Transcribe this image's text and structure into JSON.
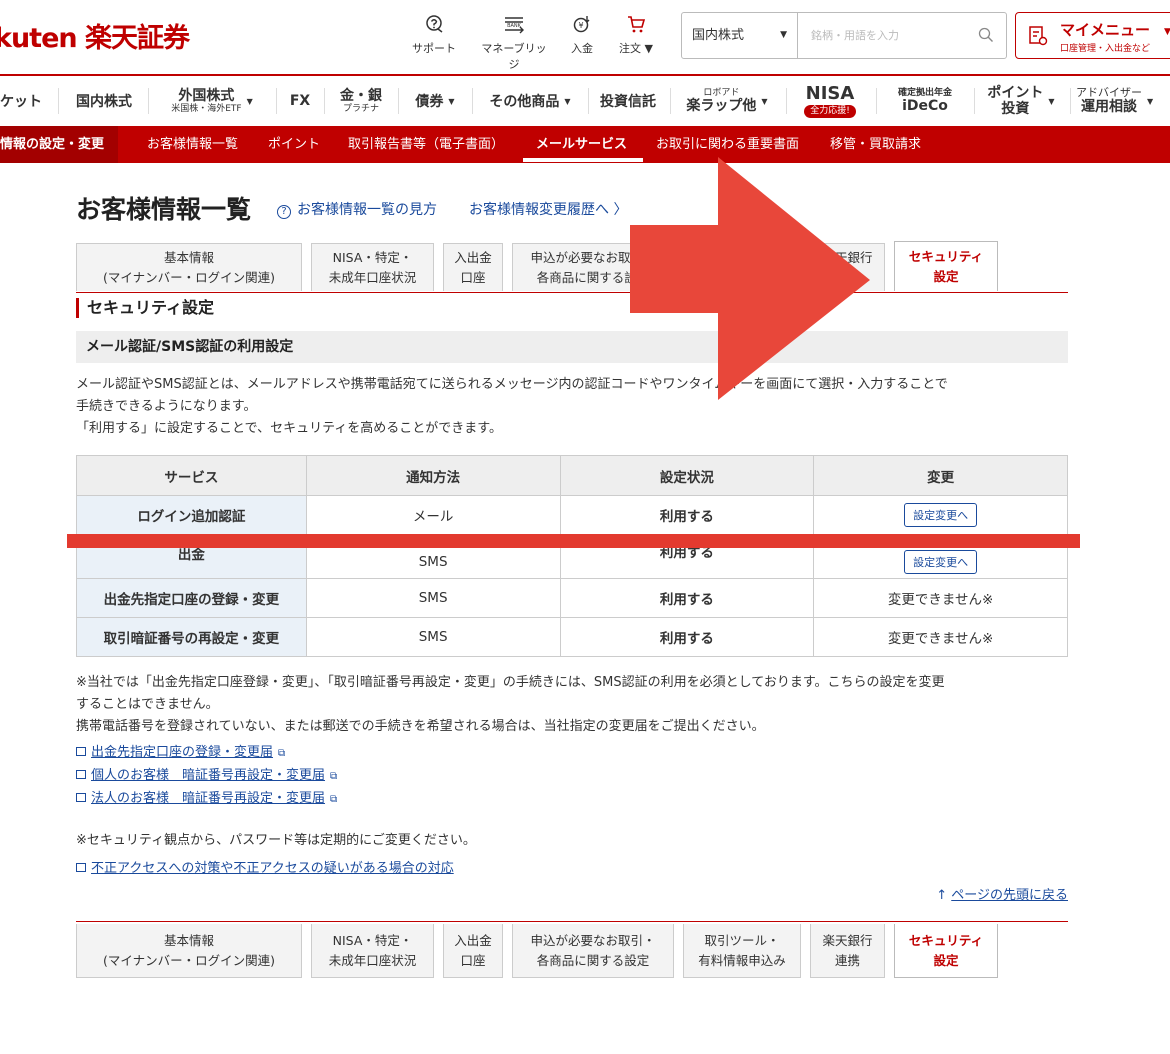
{
  "header": {
    "logo_text": "kuten 楽天証券",
    "utilities": [
      {
        "label": "サポート",
        "icon": "support-icon"
      },
      {
        "label": "マネーブリッジ",
        "icon": "money-bridge-icon"
      },
      {
        "label": "入金",
        "icon": "deposit-icon"
      },
      {
        "label": "注文 ▼",
        "icon": "cart-icon"
      }
    ],
    "search": {
      "select_value": "国内株式",
      "placeholder": "銘柄・用語を入力"
    },
    "mymenu": {
      "title": "マイメニュー",
      "subtitle": "口座管理・入出金など"
    }
  },
  "global_nav": [
    {
      "line1": "ケット",
      "line2": ""
    },
    {
      "line1": "国内株式",
      "line2": ""
    },
    {
      "line1": "外国株式",
      "line2": "米国株・海外ETF"
    },
    {
      "line1": "FX",
      "line2": ""
    },
    {
      "line1": "金・銀",
      "line2": "プラチナ"
    },
    {
      "line1": "債券",
      "line2": ""
    },
    {
      "line1": "その他商品",
      "line2": ""
    },
    {
      "line1": "投資信託",
      "line2": ""
    },
    {
      "line1": "ロボアド",
      "line2": "楽ラップ他"
    },
    {
      "line1": "NISA",
      "line2": "全力応援!"
    },
    {
      "line1": "確定拠出年金",
      "line2": "iDeCo"
    },
    {
      "line1": "ポイント",
      "line2": "投資"
    },
    {
      "line1": "アドバイザー",
      "line2": "運用相談"
    }
  ],
  "sub_nav": [
    "情報の設定・変更",
    "お客様情報一覧",
    "ポイント",
    "取引報告書等（電子書面）",
    "メールサービス",
    "お取引に関わる重要書面",
    "移管・買取請求"
  ],
  "page": {
    "title": "お客様情報一覧",
    "help_link": "お客様情報一覧の見方",
    "history_link": "お客様情報変更履歴へ 〉"
  },
  "tabs": [
    {
      "line1": "基本情報",
      "line2": "(マイナンバー・ログイン関連)"
    },
    {
      "line1": "NISA・特定・",
      "line2": "未成年口座状況"
    },
    {
      "line1": "入出金",
      "line2": "口座"
    },
    {
      "line1": "申込が必要なお取引・",
      "line2": "各商品に関する設定"
    },
    {
      "line1": "取引ツール・",
      "line2": "有料情報申込み"
    },
    {
      "line1": "楽天銀行",
      "line2": "連携"
    },
    {
      "line1": "セキュリティ",
      "line2": "設定"
    }
  ],
  "section": {
    "heading": "セキュリティ設定",
    "subheading": "メール認証/SMS認証の利用設定",
    "desc_line1": "メール認証やSMS認証とは、メールアドレスや携帯電話宛てに送られるメッセージ内の認証コードやワンタイムキーを画面にて選択・入力することで",
    "desc_line2": "手続きできるようになります。",
    "desc_line3": "「利用する」に設定することで、セキュリティを高めることができます。"
  },
  "table": {
    "headers": [
      "サービス",
      "通知方法",
      "設定状況",
      "変更"
    ],
    "rows": [
      {
        "service": "ログイン追加認証",
        "method": "メール",
        "status": "利用する",
        "change": "設定変更へ"
      },
      {
        "service": "出金",
        "method": "SMS",
        "status": "利用する",
        "change": "設定変更へ"
      },
      {
        "service": "出金先指定口座の登録・変更",
        "method": "SMS",
        "status": "利用する",
        "change": "変更できません※"
      },
      {
        "service": "取引暗証番号の再設定・変更",
        "method": "SMS",
        "status": "利用する",
        "change": "変更できません※"
      }
    ]
  },
  "notes": {
    "line1": "※当社では「出金先指定口座登録・変更」、「取引暗証番号再設定・変更」の手続きには、SMS認証の利用を必須としております。こちらの設定を変更",
    "line2": "することはできません。",
    "line3": "携帯電話番号を登録されていない、または郵送での手続きを希望される場合は、当社指定の変更届をご提出ください。"
  },
  "doc_links": [
    "出金先指定口座の登録・変更届",
    "個人のお客様　暗証番号再設定・変更届",
    "法人のお客様　暗証番号再設定・変更届"
  ],
  "pw_note": "※セキュリティ観点から、パスワード等は定期的にご変更ください。",
  "fraud_link": "不正アクセスへの対策や不正アクセスの疑いがある場合の対応",
  "top_link": "ページの先頭に戻る",
  "annotation_colors": {
    "arrow": "#e8473a",
    "line": "#e33a2f"
  }
}
